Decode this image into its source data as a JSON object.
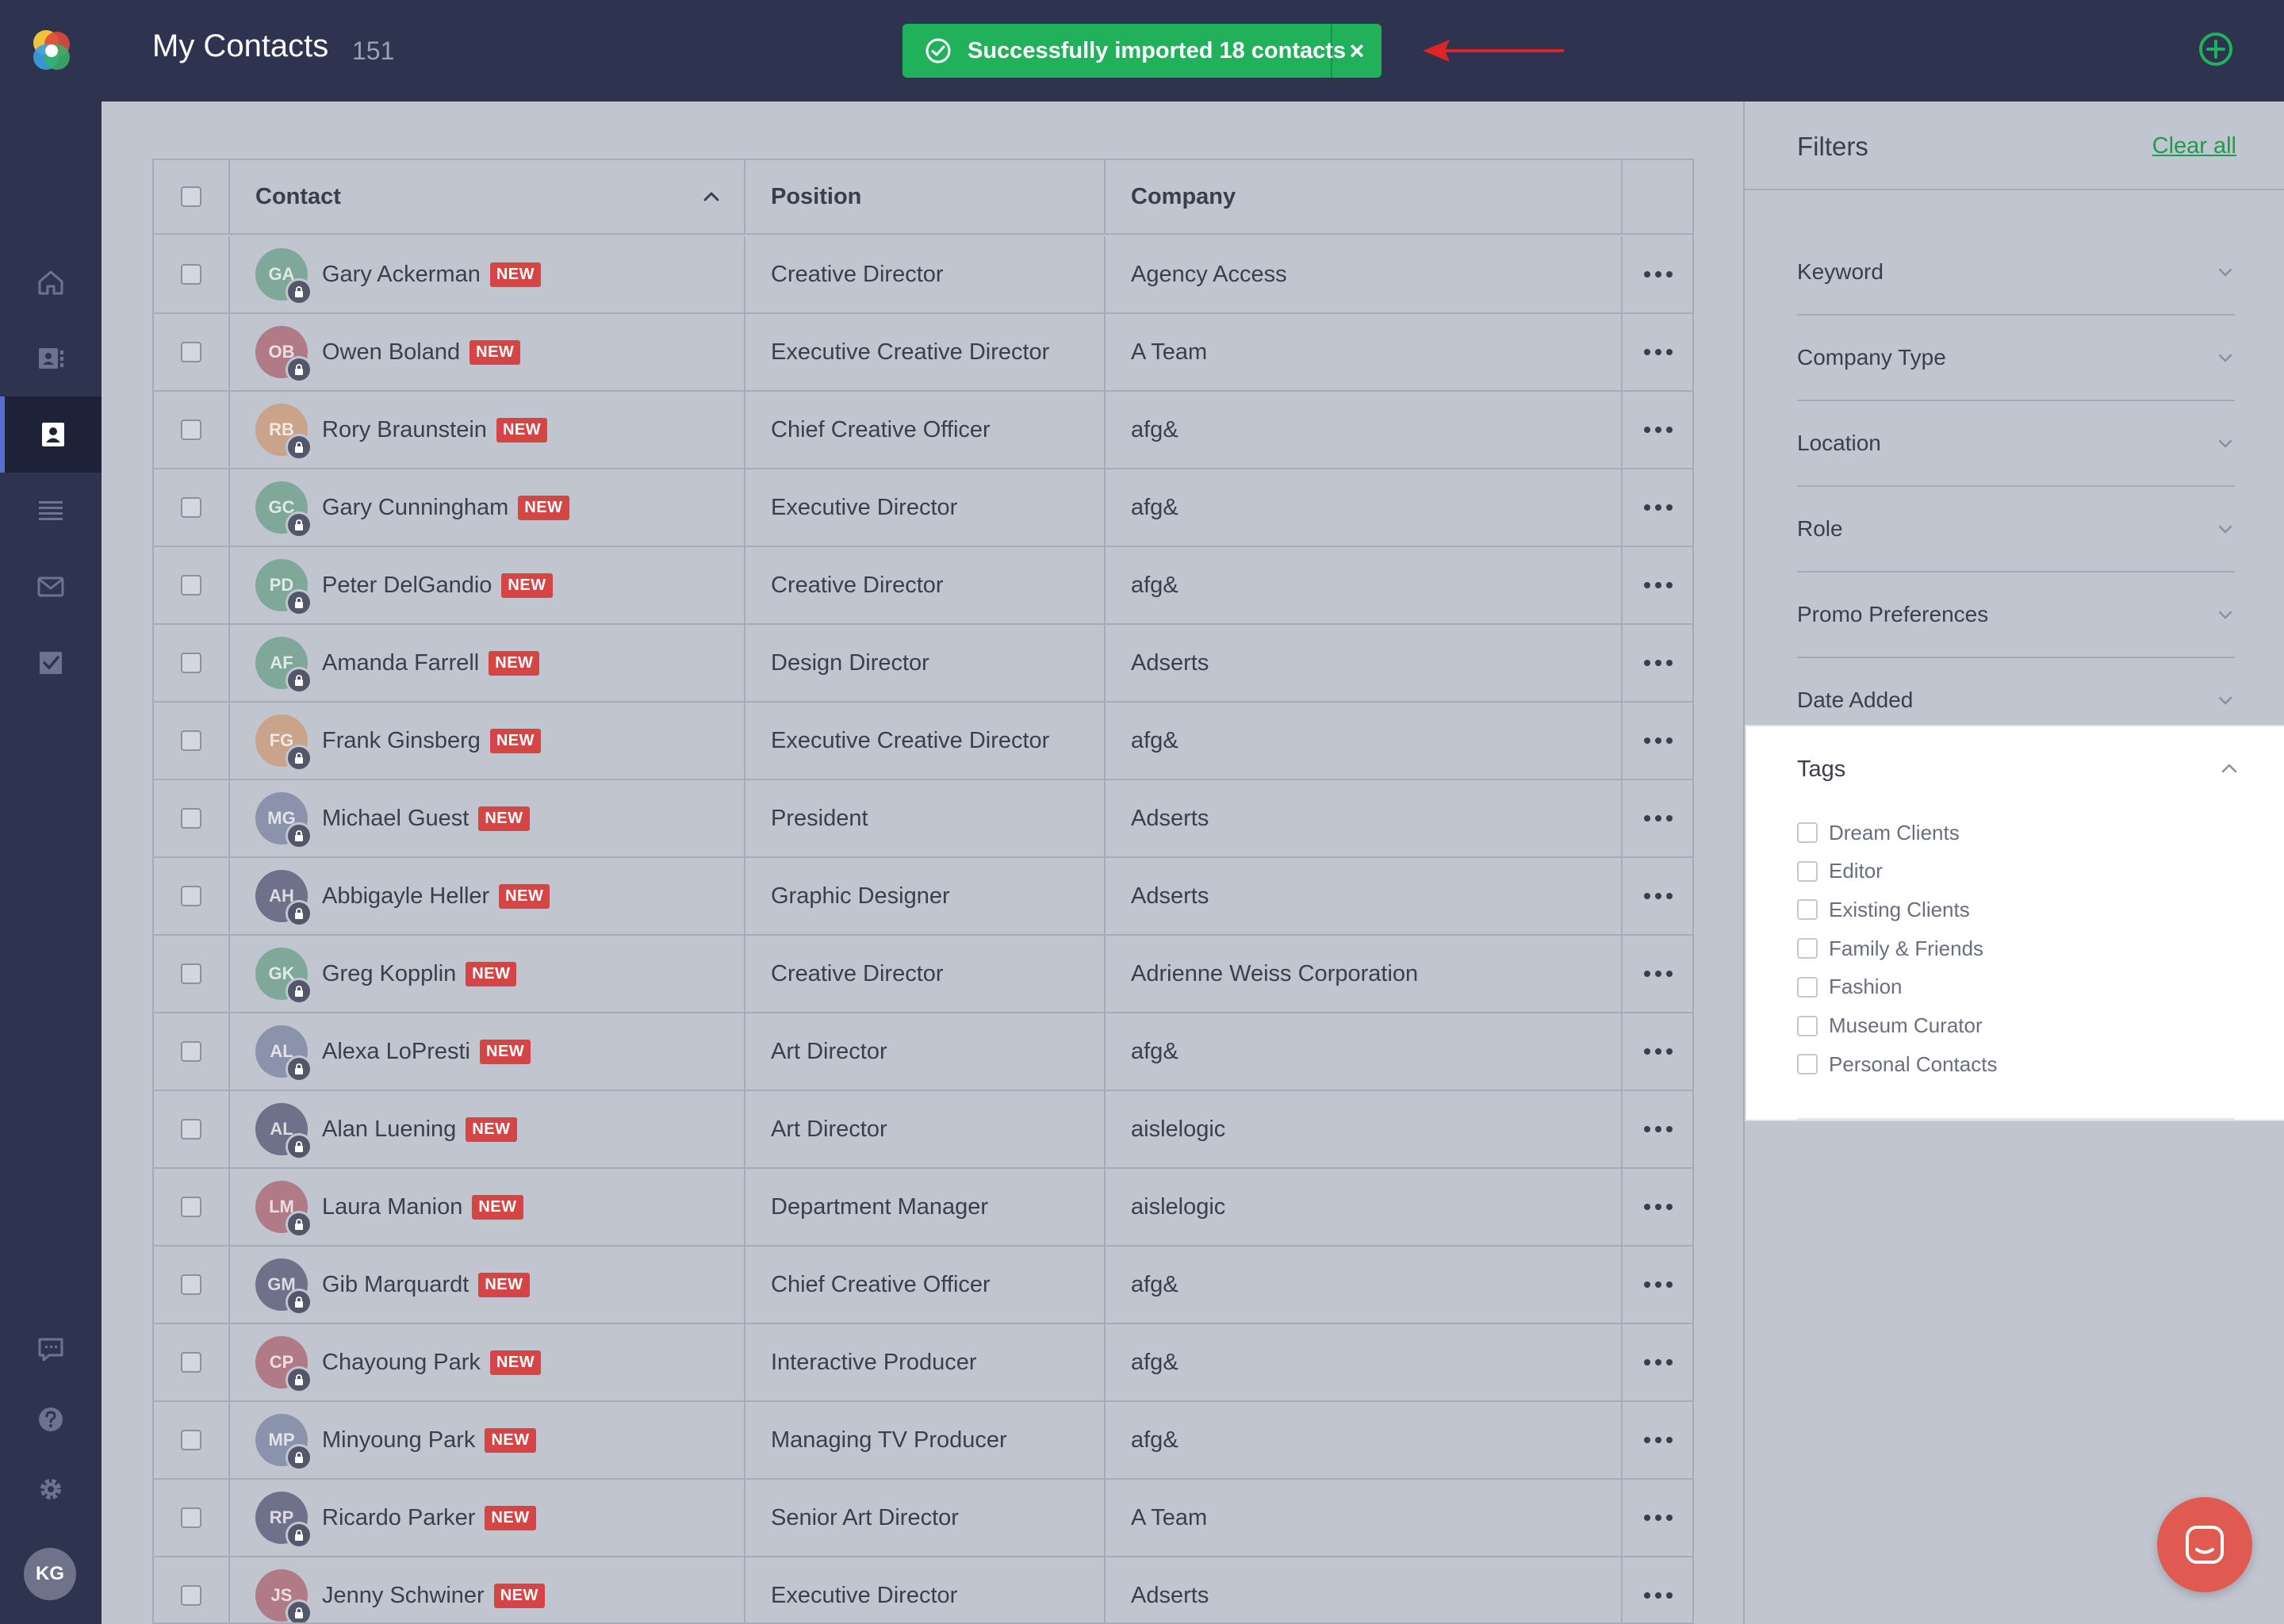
{
  "header": {
    "title": "My Contacts",
    "count": "151",
    "toast_message": "Successfully imported 18 contacts",
    "toast_close": "×"
  },
  "colors": {
    "accent": "#21b15b",
    "nav_bg": "#2e344f",
    "badge": "#d64545",
    "link": "#1f9a50"
  },
  "sidebar": {
    "items": [
      {
        "icon": "home-icon"
      },
      {
        "icon": "address-book-icon"
      },
      {
        "icon": "contact-card-icon",
        "active": true
      },
      {
        "icon": "list-icon"
      },
      {
        "icon": "mail-icon"
      },
      {
        "icon": "checkbox-task-icon"
      }
    ],
    "bottom_items": [
      {
        "icon": "feedback-icon"
      },
      {
        "icon": "help-icon"
      },
      {
        "icon": "gear-icon"
      }
    ],
    "user_initials": "KG"
  },
  "table": {
    "columns": [
      "Contact",
      "Position",
      "Company"
    ],
    "badge_label": "NEW",
    "rows": [
      {
        "initials": "GA",
        "name": "Gary Ackerman",
        "position": "Creative Director",
        "company": "Agency Access",
        "color": "#7fa89a"
      },
      {
        "initials": "OB",
        "name": "Owen Boland",
        "position": "Executive Creative Director",
        "company": "A Team",
        "color": "#b07b86"
      },
      {
        "initials": "RB",
        "name": "Rory Braunstein",
        "position": "Chief Creative Officer",
        "company": "afg&",
        "color": "#c9a38a"
      },
      {
        "initials": "GC",
        "name": "Gary Cunningham",
        "position": "Executive Director",
        "company": "afg&",
        "color": "#7fa89a"
      },
      {
        "initials": "PD",
        "name": "Peter DelGandio",
        "position": "Creative Director",
        "company": "afg&",
        "color": "#7fa89a"
      },
      {
        "initials": "AF",
        "name": "Amanda Farrell",
        "position": "Design Director",
        "company": "Adserts",
        "color": "#7fa89a"
      },
      {
        "initials": "FG",
        "name": "Frank Ginsberg",
        "position": "Executive Creative Director",
        "company": "afg&",
        "color": "#c9a38a"
      },
      {
        "initials": "MG",
        "name": "Michael Guest",
        "position": "President",
        "company": "Adserts",
        "color": "#8a93ab"
      },
      {
        "initials": "AH",
        "name": "Abbigayle Heller",
        "position": "Graphic Designer",
        "company": "Adserts",
        "color": "#6f7089"
      },
      {
        "initials": "GK",
        "name": "Greg Kopplin",
        "position": "Creative Director",
        "company": "Adrienne Weiss Corporation",
        "color": "#7fa89a"
      },
      {
        "initials": "AL",
        "name": "Alexa LoPresti",
        "position": "Art Director",
        "company": "afg&",
        "color": "#8a93ab"
      },
      {
        "initials": "AL",
        "name": "Alan Luening",
        "position": "Art Director",
        "company": "aislelogic",
        "color": "#6f7089"
      },
      {
        "initials": "LM",
        "name": "Laura Manion",
        "position": "Department Manager",
        "company": "aislelogic",
        "color": "#b07b86"
      },
      {
        "initials": "GM",
        "name": "Gib Marquardt",
        "position": "Chief Creative Officer",
        "company": "afg&",
        "color": "#6f7089"
      },
      {
        "initials": "CP",
        "name": "Chayoung Park",
        "position": "Interactive Producer",
        "company": "afg&",
        "color": "#b07b86"
      },
      {
        "initials": "MP",
        "name": "Minyoung Park",
        "position": "Managing TV Producer",
        "company": "afg&",
        "color": "#8a93ab"
      },
      {
        "initials": "RP",
        "name": "Ricardo Parker",
        "position": "Senior Art Director",
        "company": "A Team",
        "color": "#6f7089"
      },
      {
        "initials": "JS",
        "name": "Jenny Schwiner",
        "position": "Executive Director",
        "company": "Adserts",
        "color": "#b07b86"
      }
    ]
  },
  "filters": {
    "title": "Filters",
    "clear_all": "Clear all",
    "sections": [
      "Keyword",
      "Company Type",
      "Location",
      "Role",
      "Promo Preferences",
      "Date Added"
    ],
    "tags": {
      "label": "Tags",
      "options": [
        "Dream Clients",
        "Editor",
        "Existing Clients",
        "Family & Friends",
        "Fashion",
        "Museum Curator",
        "Personal Contacts"
      ]
    }
  }
}
